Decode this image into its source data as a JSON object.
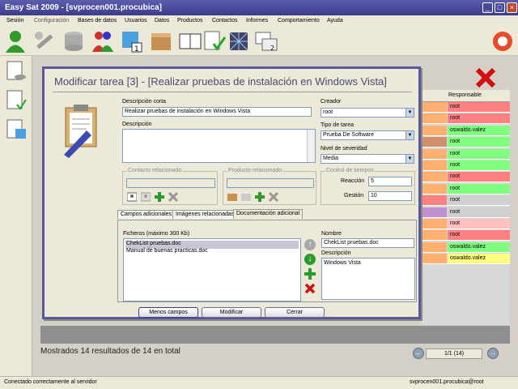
{
  "window": {
    "title": "Easy Sat 2009 - [svprocen001.procubica]"
  },
  "menu": [
    "Sesión",
    "Configuración",
    "Bases de datos",
    "Usuarios",
    "Datos",
    "Productos",
    "Contactos",
    "Informes",
    "Comportamiento",
    "Ayuda"
  ],
  "toolbar": {
    "icons": [
      "user-icon",
      "tools-icon",
      "database-icon",
      "users-icon",
      "task-icon",
      "box-icon",
      "book-icon",
      "checklist-icon",
      "network-icon",
      "windows-icon",
      "help-icon"
    ]
  },
  "grid": {
    "header": "Responsable",
    "rows": [
      {
        "value": "root",
        "color": "#ff8080"
      },
      {
        "value": "root",
        "color": "#ff8080"
      },
      {
        "value": "oswaldo.valez",
        "color": "#80ff80"
      },
      {
        "value": "root",
        "color": "#80ff80"
      },
      {
        "value": "root",
        "color": "#80ff80"
      },
      {
        "value": "root",
        "color": "#80ff80"
      },
      {
        "value": "root",
        "color": "#ff8080"
      },
      {
        "value": "root",
        "color": "#80ff80"
      },
      {
        "value": "root",
        "color": "#d0d0d0"
      },
      {
        "value": "root",
        "color": "#d0d0d0"
      },
      {
        "value": "root",
        "color": "#ffc0c0"
      },
      {
        "value": "root",
        "color": "#ff8080"
      },
      {
        "value": "oswaldo.valez",
        "color": "#80ff80"
      },
      {
        "value": "oswaldo.valez",
        "color": "#ffff80"
      }
    ],
    "left_colors": [
      "#ffb070",
      "#ffb070",
      "#ffb070",
      "#d09070",
      "#ffb070",
      "#ffb070",
      "#ffb070",
      "#ffb070",
      "#ff8080",
      "#c090d0",
      "#ffb070",
      "#ffb070",
      "#ffb070",
      "#ffb070"
    ]
  },
  "dialog": {
    "title": "Modificar tarea [3] - [Realizar pruebas de instalación en Windows Vista]",
    "short_desc_label": "Descripción corta",
    "short_desc_value": "Realizar pruebas de instalación en Windows Vista",
    "desc_label": "Descripción",
    "creator_label": "Creador",
    "creator_value": "root",
    "task_type_label": "Tipo de tarea",
    "task_type_value": "Prueba De Software",
    "severity_label": "Nivel de severidad",
    "severity_value": "Media",
    "contact_group": "Contacto relacionado",
    "product_group": "Producto relacionado",
    "time_group": "Control de tiempos",
    "reaction_label": "Reacción",
    "reaction_value": "5",
    "management_label": "Gestión",
    "management_value": "10",
    "tabs": [
      "Campos adicionales",
      "Imágenes relacionadas",
      "Documentación adicional"
    ],
    "files_label": "Ficheros (máximo 300 Kb)",
    "files": [
      "ChekList pruebas.doc",
      "Manual de buenas practicas.doc"
    ],
    "name_label": "Nombre",
    "name_value": "ChekList pruebas.doc",
    "file_desc_label": "Descripción",
    "file_desc_value": "Windows Vista",
    "buttons": {
      "less": "Menos campos",
      "modify": "Modificar",
      "close": "Cerrar"
    }
  },
  "status": {
    "results": "Mostrados 14 resultados de 14 en total",
    "pager": "1/1 (14)",
    "left": "Conectado correctamente al servidor",
    "right": "svprocen001.procubica@root"
  }
}
